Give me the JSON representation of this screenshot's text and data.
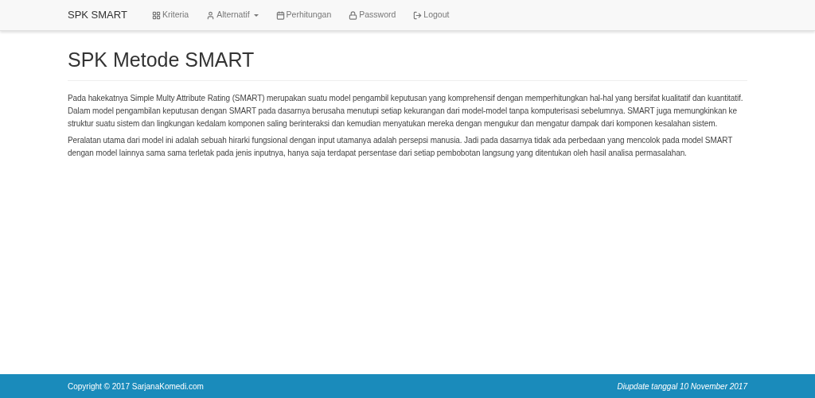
{
  "navbar": {
    "brand": "SPK SMART",
    "items": [
      {
        "label": "Kriteria",
        "dropdown": false
      },
      {
        "label": "Alternatif",
        "dropdown": true
      },
      {
        "label": "Perhitungan",
        "dropdown": false
      },
      {
        "label": "Password",
        "dropdown": false
      },
      {
        "label": "Logout",
        "dropdown": false
      }
    ]
  },
  "heading": "SPK Metode SMART",
  "paragraphs": [
    "Pada hakekatnya Simple Multy Attribute Rating (SMART) merupakan suatu model pengambil keputusan yang komprehensif dengan memperhitungkan hal-hal yang bersifat kualitatif dan kuantitatif. Dalam model pengambilan keputusan dengan SMART pada dasarnya berusaha menutupi setiap kekurangan dari model-model tanpa komputerisasi sebelumnya. SMART juga memungkinkan ke struktur suatu sistem dan lingkungan kedalam komponen saling berinteraksi dan kemudian menyatukan mereka dengan mengukur dan mengatur dampak dari komponen kesalahan sistem.",
    "Peralatan utama dari model ini adalah sebuah hirarki fungsional dengan input utamanya adalah persepsi manusia. Jadi pada dasarnya tidak ada perbedaan yang mencolok pada model SMART dengan model lainnya sama sama terletak pada jenis inputnya, hanya saja terdapat persentase dari setiap pembobotan langsung yang ditentukan oleh hasil analisa permasalahan."
  ],
  "footer": {
    "copyright": "Copyright © 2017 SarjanaKomedi.com",
    "updated": "Diupdate tanggal 10 November 2017"
  }
}
